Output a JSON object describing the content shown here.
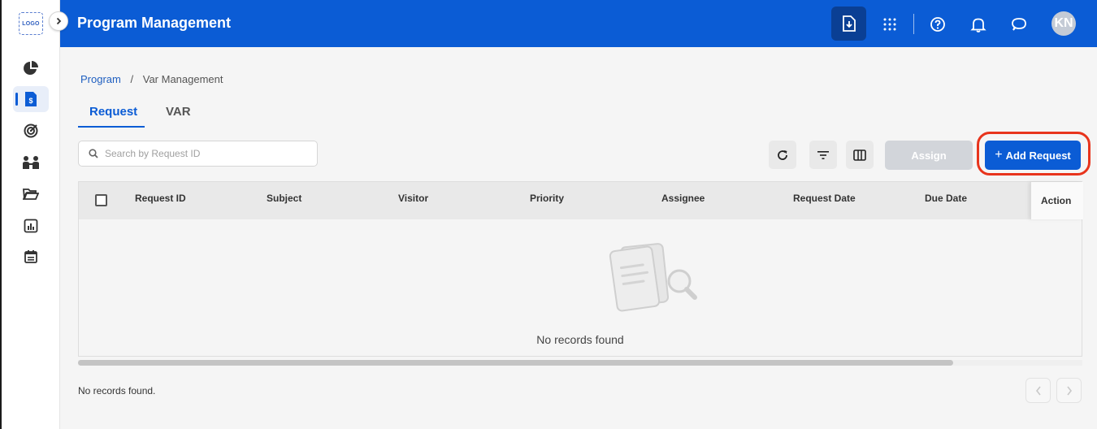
{
  "sidebar": {
    "logo_text": "LOGO",
    "items": [
      {
        "icon": "pie-chart-icon"
      },
      {
        "icon": "document-dollar-icon",
        "active": true
      },
      {
        "icon": "target-icon"
      },
      {
        "icon": "people-icon"
      },
      {
        "icon": "folder-open-icon"
      },
      {
        "icon": "bar-chart-icon"
      },
      {
        "icon": "calendar-icon"
      }
    ]
  },
  "header": {
    "title": "Program Management",
    "icons": [
      "download-icon",
      "apps-grid-icon",
      "help-icon",
      "bell-icon",
      "chat-icon"
    ],
    "avatar_initials": "KN",
    "brand_color": "#0b5cd5"
  },
  "breadcrumb": {
    "root": "Program",
    "separator": "/",
    "current": "Var Management"
  },
  "tabs": [
    {
      "label": "Request",
      "active": true
    },
    {
      "label": "VAR",
      "active": false
    }
  ],
  "search": {
    "placeholder": "Search by Request ID",
    "value": ""
  },
  "toolbar": {
    "assign_label": "Assign",
    "add_label": "Add Request",
    "add_plus": "+"
  },
  "table": {
    "columns": [
      "Request ID",
      "Subject",
      "Visitor",
      "Priority",
      "Assignee",
      "Request Date",
      "Due Date"
    ],
    "action_column": "Action",
    "rows": [],
    "empty_message": "No records found"
  },
  "footer": {
    "status": "No records found."
  }
}
